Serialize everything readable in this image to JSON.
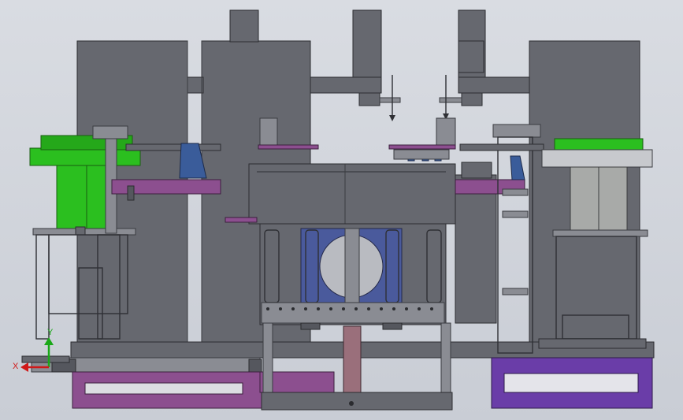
{
  "viewport": {
    "background": "#cfd3da",
    "triad": {
      "x_label": "X",
      "y_label": "Y",
      "x_color": "#d01818",
      "y_color": "#1aa818"
    }
  },
  "colors": {
    "hopper_green": "#2bbf1f",
    "base_purple": "#8c4f8f",
    "base_violet": "#6a3da8",
    "window_blue": "#4a5a9c",
    "machine_grey": "#66686f"
  }
}
